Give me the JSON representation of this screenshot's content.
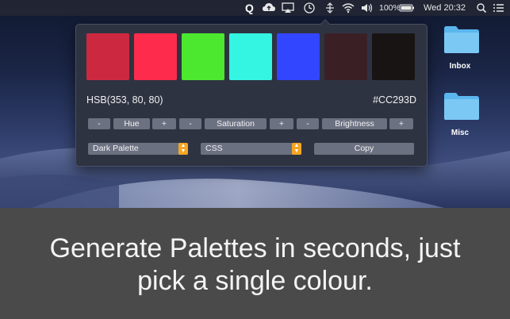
{
  "menubar": {
    "icons": [
      "quick-palette-app-icon",
      "cloud-upload-icon",
      "airplay-icon",
      "time-machine-icon",
      "network-icon",
      "wifi-icon",
      "volume-icon",
      "battery-icon",
      "search-icon",
      "list-icon"
    ],
    "battery_percent": "100%",
    "clock": "Wed 20:32"
  },
  "palette": {
    "swatches": [
      "#CC2940",
      "#FF2B4D",
      "#4CE82F",
      "#34F4E2",
      "#3246FF",
      "#3A2025",
      "#181414"
    ],
    "hsb_text": "HSB(353, 80, 80)",
    "hex_text": "#CC293D",
    "adjusters": [
      {
        "minus": "-",
        "label": "Hue",
        "plus": "+"
      },
      {
        "minus": "-",
        "label": "Saturation",
        "plus": "+"
      },
      {
        "minus": "-",
        "label": "Brightness",
        "plus": "+"
      }
    ],
    "palette_select": "Dark Palette",
    "format_select": "CSS",
    "copy_label": "Copy"
  },
  "desktop": {
    "folders": [
      {
        "label": "Inbox"
      },
      {
        "label": "Misc"
      }
    ],
    "folder_color": "#5BB6EE"
  },
  "caption": {
    "line1": "Generate Palettes in seconds, just",
    "line2": "pick a single colour."
  }
}
